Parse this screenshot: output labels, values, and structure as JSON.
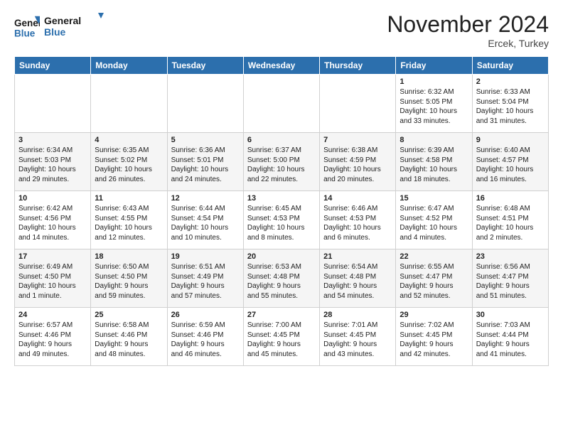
{
  "header": {
    "logo_line1": "General",
    "logo_line2": "Blue",
    "month_title": "November 2024",
    "subtitle": "Ercek, Turkey"
  },
  "days_of_week": [
    "Sunday",
    "Monday",
    "Tuesday",
    "Wednesday",
    "Thursday",
    "Friday",
    "Saturday"
  ],
  "weeks": [
    [
      {
        "day": "",
        "info": ""
      },
      {
        "day": "",
        "info": ""
      },
      {
        "day": "",
        "info": ""
      },
      {
        "day": "",
        "info": ""
      },
      {
        "day": "",
        "info": ""
      },
      {
        "day": "1",
        "info": "Sunrise: 6:32 AM\nSunset: 5:05 PM\nDaylight: 10 hours\nand 33 minutes."
      },
      {
        "day": "2",
        "info": "Sunrise: 6:33 AM\nSunset: 5:04 PM\nDaylight: 10 hours\nand 31 minutes."
      }
    ],
    [
      {
        "day": "3",
        "info": "Sunrise: 6:34 AM\nSunset: 5:03 PM\nDaylight: 10 hours\nand 29 minutes."
      },
      {
        "day": "4",
        "info": "Sunrise: 6:35 AM\nSunset: 5:02 PM\nDaylight: 10 hours\nand 26 minutes."
      },
      {
        "day": "5",
        "info": "Sunrise: 6:36 AM\nSunset: 5:01 PM\nDaylight: 10 hours\nand 24 minutes."
      },
      {
        "day": "6",
        "info": "Sunrise: 6:37 AM\nSunset: 5:00 PM\nDaylight: 10 hours\nand 22 minutes."
      },
      {
        "day": "7",
        "info": "Sunrise: 6:38 AM\nSunset: 4:59 PM\nDaylight: 10 hours\nand 20 minutes."
      },
      {
        "day": "8",
        "info": "Sunrise: 6:39 AM\nSunset: 4:58 PM\nDaylight: 10 hours\nand 18 minutes."
      },
      {
        "day": "9",
        "info": "Sunrise: 6:40 AM\nSunset: 4:57 PM\nDaylight: 10 hours\nand 16 minutes."
      }
    ],
    [
      {
        "day": "10",
        "info": "Sunrise: 6:42 AM\nSunset: 4:56 PM\nDaylight: 10 hours\nand 14 minutes."
      },
      {
        "day": "11",
        "info": "Sunrise: 6:43 AM\nSunset: 4:55 PM\nDaylight: 10 hours\nand 12 minutes."
      },
      {
        "day": "12",
        "info": "Sunrise: 6:44 AM\nSunset: 4:54 PM\nDaylight: 10 hours\nand 10 minutes."
      },
      {
        "day": "13",
        "info": "Sunrise: 6:45 AM\nSunset: 4:53 PM\nDaylight: 10 hours\nand 8 minutes."
      },
      {
        "day": "14",
        "info": "Sunrise: 6:46 AM\nSunset: 4:53 PM\nDaylight: 10 hours\nand 6 minutes."
      },
      {
        "day": "15",
        "info": "Sunrise: 6:47 AM\nSunset: 4:52 PM\nDaylight: 10 hours\nand 4 minutes."
      },
      {
        "day": "16",
        "info": "Sunrise: 6:48 AM\nSunset: 4:51 PM\nDaylight: 10 hours\nand 2 minutes."
      }
    ],
    [
      {
        "day": "17",
        "info": "Sunrise: 6:49 AM\nSunset: 4:50 PM\nDaylight: 10 hours\nand 1 minute."
      },
      {
        "day": "18",
        "info": "Sunrise: 6:50 AM\nSunset: 4:50 PM\nDaylight: 9 hours\nand 59 minutes."
      },
      {
        "day": "19",
        "info": "Sunrise: 6:51 AM\nSunset: 4:49 PM\nDaylight: 9 hours\nand 57 minutes."
      },
      {
        "day": "20",
        "info": "Sunrise: 6:53 AM\nSunset: 4:48 PM\nDaylight: 9 hours\nand 55 minutes."
      },
      {
        "day": "21",
        "info": "Sunrise: 6:54 AM\nSunset: 4:48 PM\nDaylight: 9 hours\nand 54 minutes."
      },
      {
        "day": "22",
        "info": "Sunrise: 6:55 AM\nSunset: 4:47 PM\nDaylight: 9 hours\nand 52 minutes."
      },
      {
        "day": "23",
        "info": "Sunrise: 6:56 AM\nSunset: 4:47 PM\nDaylight: 9 hours\nand 51 minutes."
      }
    ],
    [
      {
        "day": "24",
        "info": "Sunrise: 6:57 AM\nSunset: 4:46 PM\nDaylight: 9 hours\nand 49 minutes."
      },
      {
        "day": "25",
        "info": "Sunrise: 6:58 AM\nSunset: 4:46 PM\nDaylight: 9 hours\nand 48 minutes."
      },
      {
        "day": "26",
        "info": "Sunrise: 6:59 AM\nSunset: 4:46 PM\nDaylight: 9 hours\nand 46 minutes."
      },
      {
        "day": "27",
        "info": "Sunrise: 7:00 AM\nSunset: 4:45 PM\nDaylight: 9 hours\nand 45 minutes."
      },
      {
        "day": "28",
        "info": "Sunrise: 7:01 AM\nSunset: 4:45 PM\nDaylight: 9 hours\nand 43 minutes."
      },
      {
        "day": "29",
        "info": "Sunrise: 7:02 AM\nSunset: 4:45 PM\nDaylight: 9 hours\nand 42 minutes."
      },
      {
        "day": "30",
        "info": "Sunrise: 7:03 AM\nSunset: 4:44 PM\nDaylight: 9 hours\nand 41 minutes."
      }
    ]
  ]
}
